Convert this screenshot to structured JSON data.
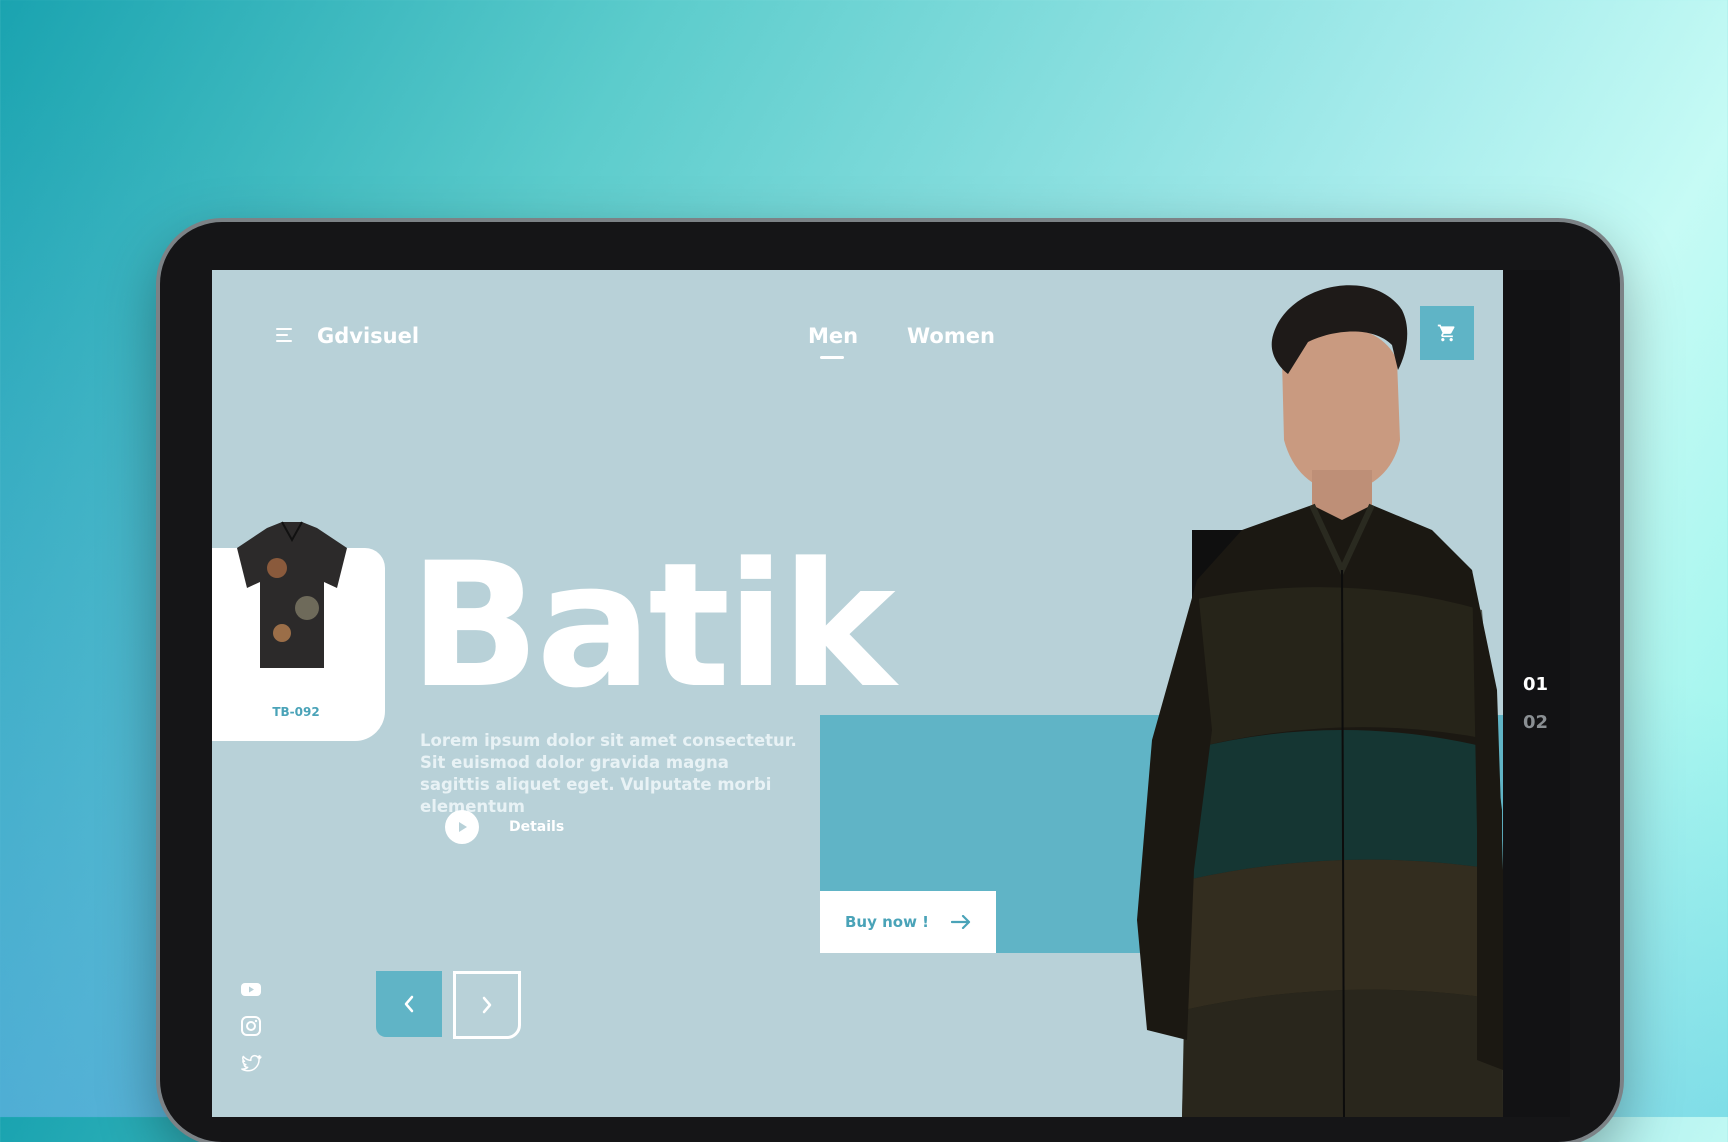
{
  "brand": {
    "name": "Gdvisuel"
  },
  "nav": {
    "items": [
      {
        "label": "Men",
        "active": true
      },
      {
        "label": "Women",
        "active": false
      }
    ]
  },
  "hero": {
    "title": "Batik",
    "description": "Lorem ipsum dolor sit amet consectetur. Sit euismod dolor gravida magna sagittis aliquet eget. Vulputate morbi elementum",
    "details_label": "Details",
    "buy_label": "Buy now !"
  },
  "product_card": {
    "code": "TB-092"
  },
  "slides": {
    "items": [
      "01",
      "02"
    ],
    "active": "01"
  },
  "social": [
    "youtube-icon",
    "instagram-icon",
    "twitter-icon"
  ],
  "icons": {
    "menu": "hamburger-icon",
    "cart": "cart-icon",
    "play": "play-icon",
    "arrow": "arrow-right-icon",
    "prev": "chevron-left-icon",
    "next": "chevron-right-icon"
  },
  "colors": {
    "screen_bg": "#b8d1d8",
    "accent": "#60b4c6",
    "text_white": "#ffffff",
    "device": "#151517"
  }
}
